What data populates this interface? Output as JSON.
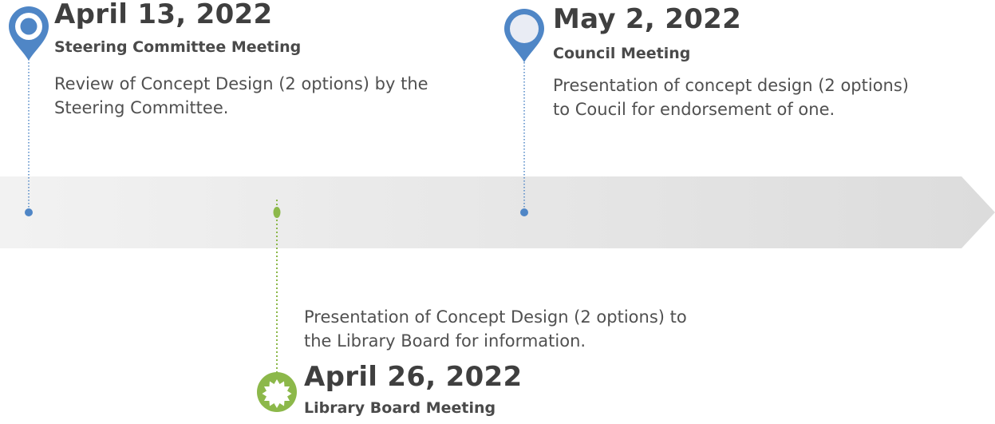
{
  "events": [
    {
      "date": "April 13, 2022",
      "title": "Steering Committee Meeting",
      "description": "Review of Concept Design (2 options) by the Steering Committee.",
      "icon": "map-pin-icon",
      "color": "#4f86c6"
    },
    {
      "date": "May 2, 2022",
      "title": "Council Meeting",
      "description": "Presentation of concept design (2 options) to Coucil for endorsement of one.",
      "icon": "map-pin-icon",
      "color": "#4f86c6"
    },
    {
      "date": "April 26, 2022",
      "title": "Library Board Meeting",
      "description": "Presentation of Concept Design (2 options) to the Library Board for information.",
      "icon": "starburst-badge-icon",
      "color": "#8cb84a"
    }
  ],
  "colors": {
    "arrow": "#ececec",
    "blue": "#4f86c6",
    "green": "#8cb84a"
  }
}
